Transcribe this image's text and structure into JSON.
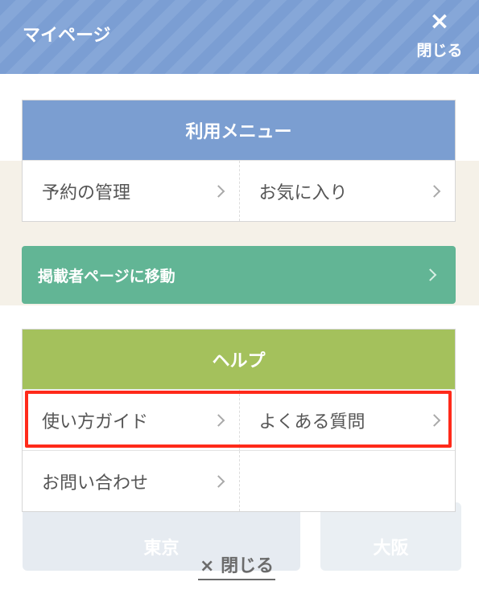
{
  "header": {
    "title": "マイページ",
    "close_icon": "×",
    "close_label": "閉じる"
  },
  "use_menu": {
    "title": "利用メニュー",
    "items": [
      {
        "label": "予約の管理"
      },
      {
        "label": "お気に入り"
      }
    ]
  },
  "move_button": {
    "label": "掲載者ページに移動"
  },
  "help_menu": {
    "title": "ヘルプ",
    "items": [
      {
        "label": "使い方ガイド"
      },
      {
        "label": "よくある質問"
      },
      {
        "label": "お問い合わせ"
      }
    ]
  },
  "bottom_close": {
    "label": "× 閉じる"
  },
  "background": {
    "cards": [
      "東京",
      "大阪"
    ]
  },
  "colors": {
    "header": "#7b9ed3",
    "use_menu": "#7b9ed1",
    "move_button": "#62b595",
    "help_menu": "#a4c15c",
    "highlight": "#ff2a1a"
  }
}
